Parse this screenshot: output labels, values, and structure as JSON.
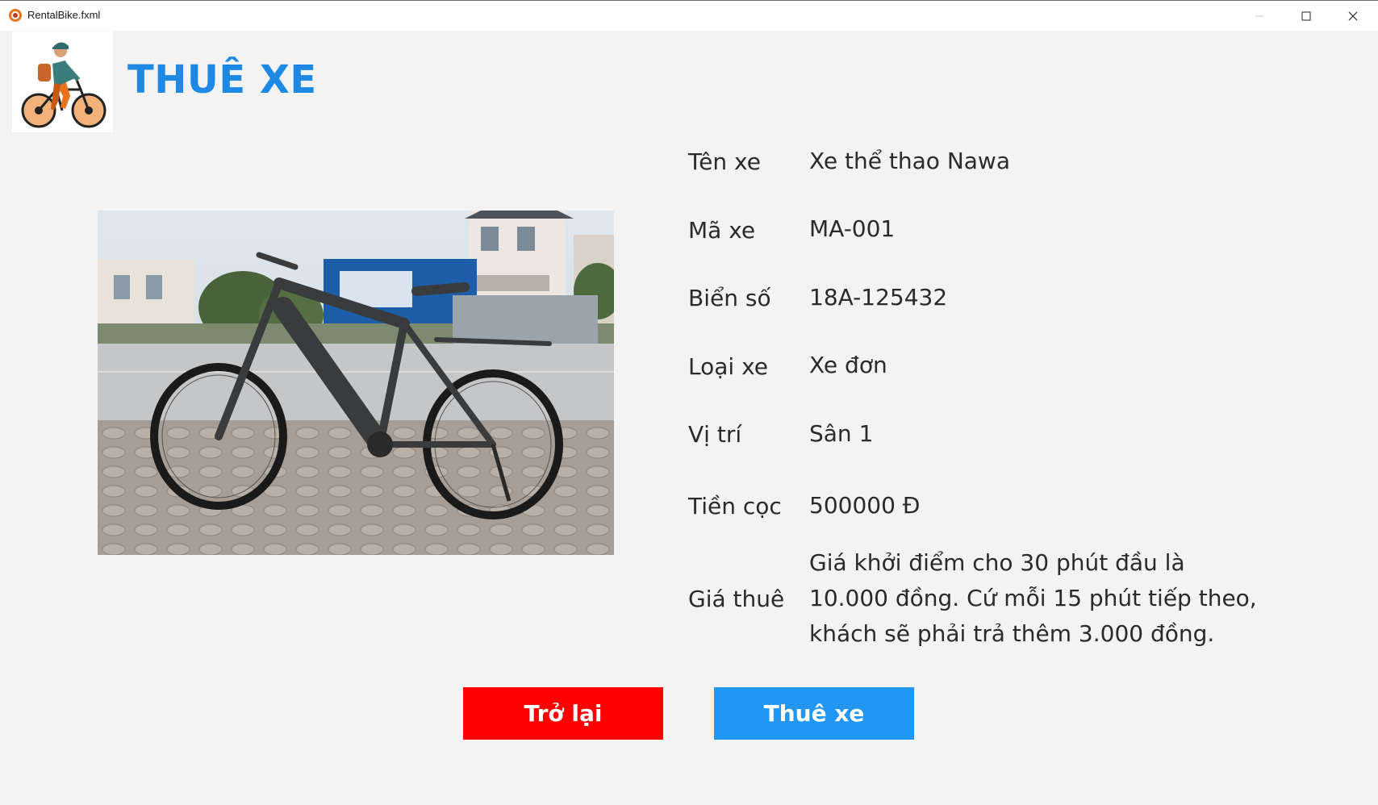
{
  "window": {
    "title": "RentalBike.fxml"
  },
  "header": {
    "title": "THUÊ XE"
  },
  "details": [
    {
      "label": "Tên xe",
      "value": "Xe thể thao Nawa"
    },
    {
      "label": "Mã xe",
      "value": "MA-001"
    },
    {
      "label": "Biển số",
      "value": "18A-125432"
    },
    {
      "label": "Loại xe",
      "value": "Xe đơn"
    },
    {
      "label": "Vị trí",
      "value": "Sân 1"
    },
    {
      "label": "Tiền cọc",
      "value": "500000 Đ"
    },
    {
      "label": "Giá thuê",
      "value": " Giá khởi điểm cho 30 phút đầu là 10.000 đồng. Cứ mỗi 15 phút tiếp theo, khách sẽ phải trả thêm 3.000 đồng."
    }
  ],
  "buttons": {
    "back": "Trở lại",
    "rent": "Thuê xe"
  },
  "colors": {
    "title": "#1e88e5",
    "back_button": "#ff0000",
    "rent_button": "#2196f3",
    "background": "#f3f3f3"
  }
}
